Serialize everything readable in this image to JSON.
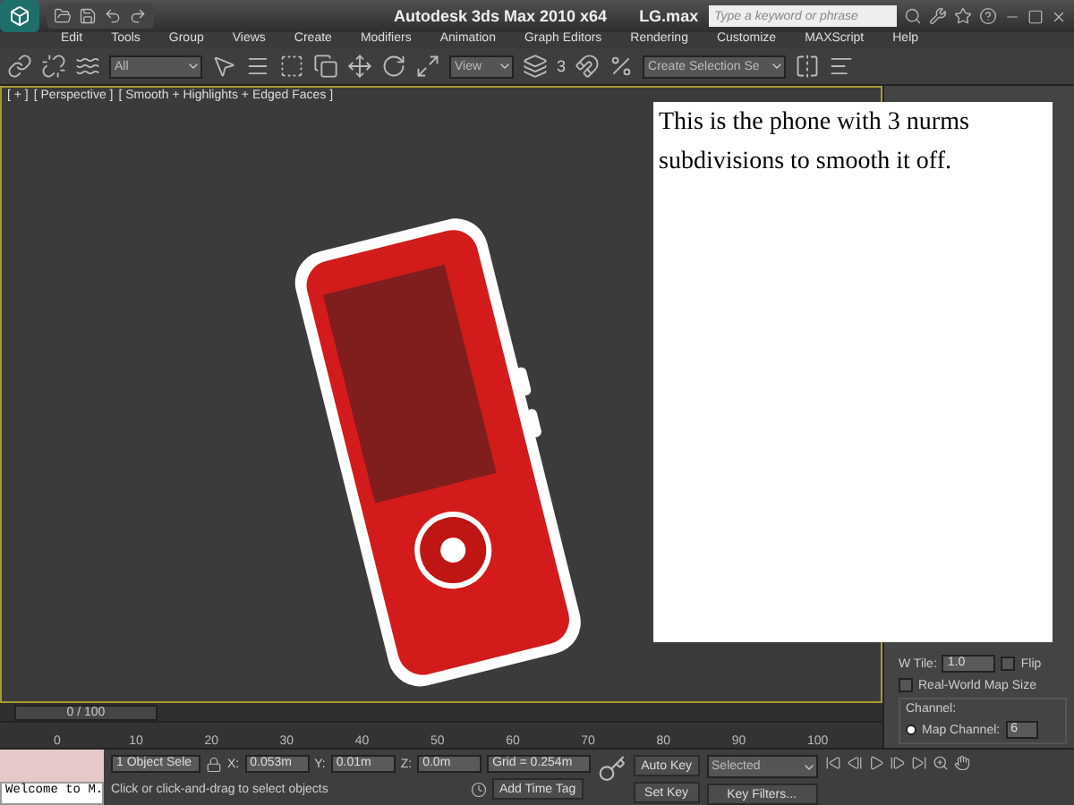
{
  "title_bar": {
    "title": "Autodesk 3ds Max  2010 x64",
    "file": "LG.max",
    "search": {
      "placeholder": "Type a keyword or phrase"
    }
  },
  "menu": [
    "Edit",
    "Tools",
    "Group",
    "Views",
    "Create",
    "Modifiers",
    "Animation",
    "Graph Editors",
    "Rendering",
    "Customize",
    "MAXScript",
    "Help"
  ],
  "toolbar": {
    "selection_filter": "All",
    "reference_coord": "View",
    "snap_label": "3",
    "named_selection": "Create Selection Se"
  },
  "viewport": {
    "labels": [
      "[ + ]",
      "[ Perspective ]",
      "[ Smooth + Highlights + Edged Faces ]"
    ]
  },
  "note": "This is the phone with 3 nurms subdivisions to smooth it off.",
  "command_panel": {
    "w_tile_label": "W Tile:",
    "w_tile": "1.0",
    "flip": {
      "label": "Flip",
      "checked": false
    },
    "real_world": {
      "label": "Real-World Map Size",
      "checked": false
    },
    "channel_group": "Channel:",
    "map_channel": {
      "label": "Map Channel:",
      "value": "6",
      "selected": true
    }
  },
  "timeline": {
    "frame": "0 / 100",
    "ticks": [
      "0",
      "10",
      "20",
      "30",
      "40",
      "50",
      "60",
      "70",
      "80",
      "90",
      "100"
    ]
  },
  "status": {
    "maxscript": "Welcome to M.",
    "selection": "1 Object Sele",
    "x_label": "X:",
    "x": "0.053m",
    "y_label": "Y:",
    "y": "0.01m",
    "z_label": "Z:",
    "z": "0.0m",
    "grid": "Grid = 0.254m",
    "prompt": "Click or click-and-drag to select objects",
    "add_time_tag": "Add Time Tag",
    "auto_key": "Auto Key",
    "set_key": "Set Key",
    "key_mode": "Selected",
    "key_filters": "Key Filters..."
  }
}
